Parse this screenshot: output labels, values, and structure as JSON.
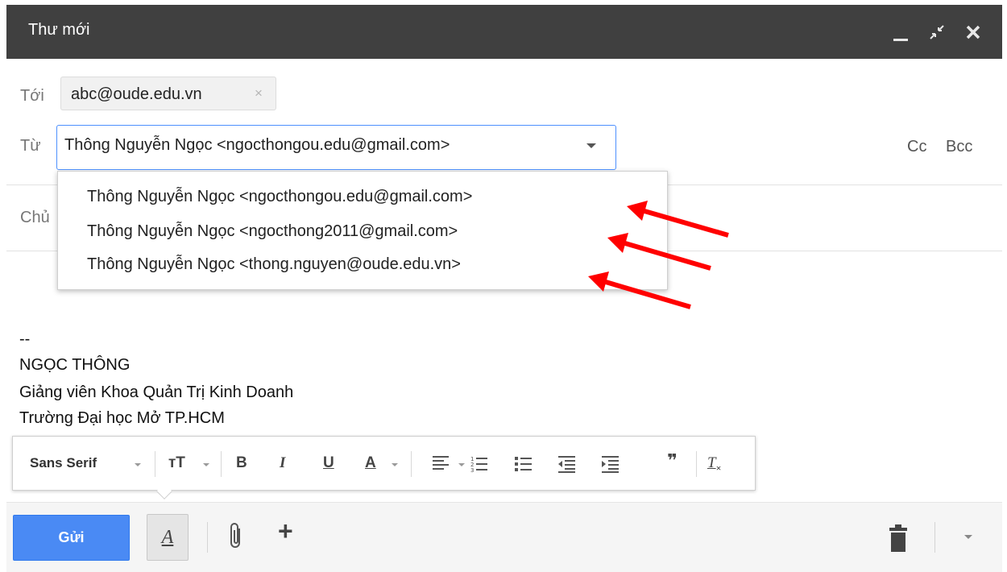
{
  "window": {
    "title": "Thư mới",
    "minimize_icon": "minimize-icon",
    "popout_icon": "popout-icon",
    "close_icon": "close-icon"
  },
  "to": {
    "label": "Tới",
    "recipient": "abc@oude.edu.vn",
    "remove_icon": "×"
  },
  "from": {
    "label": "Từ",
    "selected": "Thông Nguyễn Ngọc <ngocthongou.edu@gmail.com>",
    "options": [
      "Thông Nguyễn Ngọc <ngocthongou.edu@gmail.com>",
      "Thông Nguyễn Ngọc <ngocthong2011@gmail.com>",
      "Thông Nguyễn Ngọc <thong.nguyen@oude.edu.vn>"
    ]
  },
  "cc_label": "Cc",
  "bcc_label": "Bcc",
  "subject": {
    "label": "Chủ"
  },
  "signature": {
    "lines": [
      "--",
      "NGỌC THÔNG",
      "Giảng viên Khoa Quản Trị Kinh Doanh",
      "Trường Đại học Mở TP.HCM"
    ]
  },
  "format_toolbar": {
    "font": "Sans Serif",
    "size_icon": "тT",
    "bold": "B",
    "italic": "I",
    "underline": "U",
    "text_color": "A",
    "quote": "❞",
    "clear_formatting": "T"
  },
  "bottom_bar": {
    "send_label": "Gửi",
    "formatting_toggle": "A",
    "plus": "+"
  },
  "colors": {
    "title_bar": "#404040",
    "send_button": "#4a8af4",
    "focus_border": "#4d90fe",
    "annotation_arrow": "#ff0000"
  }
}
